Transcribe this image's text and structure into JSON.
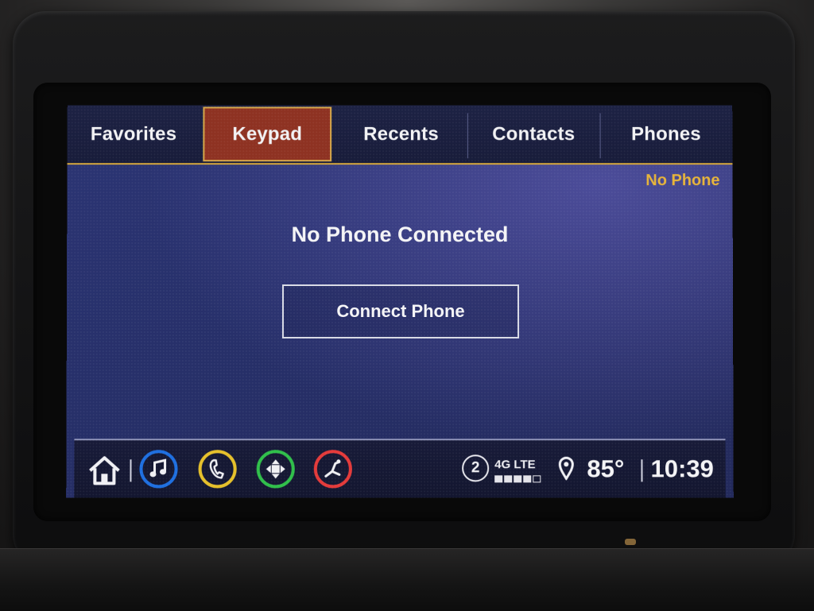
{
  "tabs": [
    {
      "label": "Favorites",
      "active": false
    },
    {
      "label": "Keypad",
      "active": true
    },
    {
      "label": "Recents",
      "active": false
    },
    {
      "label": "Contacts",
      "active": false
    },
    {
      "label": "Phones",
      "active": false
    }
  ],
  "status_note": "No Phone",
  "main": {
    "title": "No Phone Connected",
    "connect_button": "Connect Phone"
  },
  "dock": {
    "apps": [
      {
        "name": "audio",
        "icon": "music-note-icon",
        "ring_color": "#1e6fe0"
      },
      {
        "name": "phone",
        "icon": "phone-handset-icon",
        "ring_color": "#e6c02a"
      },
      {
        "name": "navigation",
        "icon": "arrows-dpad-icon",
        "ring_color": "#2fbf4a"
      },
      {
        "name": "climate",
        "icon": "seat-icon",
        "ring_color": "#e43a3a"
      }
    ],
    "bluetooth_badge": "2",
    "network": "4G LTE",
    "signal_bars_filled": 4,
    "signal_bars_total": 5,
    "temperature": "85°",
    "time": "10:39"
  },
  "colors": {
    "accent_gold": "#d7a83a",
    "active_tab": "#8e3222",
    "status_note": "#e7b43a"
  }
}
